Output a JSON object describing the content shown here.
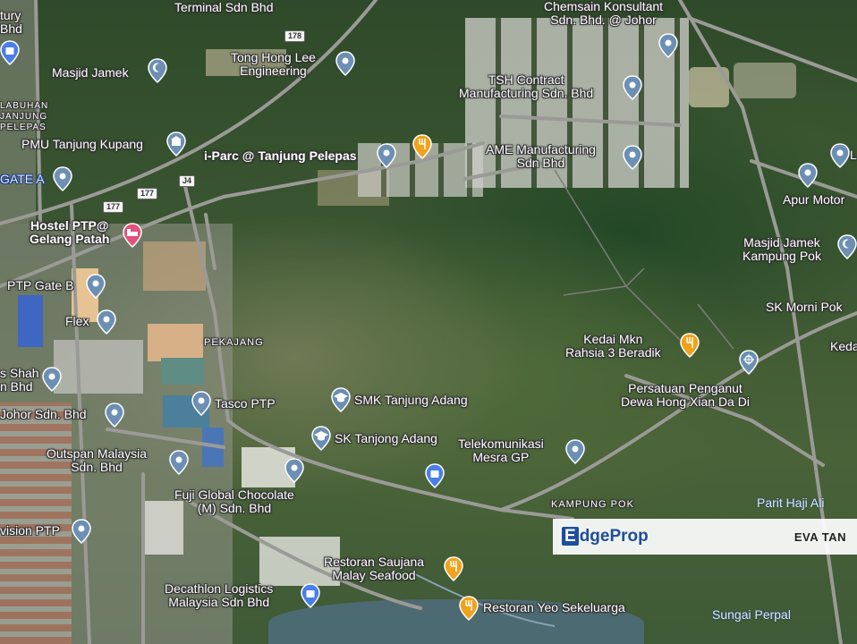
{
  "map": {
    "places": [
      {
        "text": "Terminal Sdn Bhd",
        "kind": "label"
      },
      {
        "text": "Chemsain Konsultant\nSdn. Bhd. @ Johor",
        "kind": "business"
      },
      {
        "text": "tury\nBhd",
        "kind": "label"
      },
      {
        "text": "Tong Hong Lee\nEngineering",
        "kind": "business"
      },
      {
        "text": "Masjid Jamek",
        "kind": "mosque"
      },
      {
        "text": "TSH Contract\nManufacturing Sdn. Bhd",
        "kind": "business"
      },
      {
        "text": "LABUHAN\nJANJUNG\nPELEPAS",
        "kind": "area"
      },
      {
        "text": "PMU Tanjung Kupang",
        "kind": "government"
      },
      {
        "text": "i-Parc @ Tanjung Pelepas",
        "kind": "business"
      },
      {
        "text": "AME Manufacturing\nSdn Bhd",
        "kind": "business"
      },
      {
        "text": "GATE A",
        "kind": "gate"
      },
      {
        "text": "Apur Motor",
        "kind": "business"
      },
      {
        "text": "Hostel PTP@\nGelang Patah",
        "kind": "lodging"
      },
      {
        "text": "Masjid Jamek\nKampung Pok",
        "kind": "mosque"
      },
      {
        "text": "PTP Gate B",
        "kind": "gate"
      },
      {
        "text": "SK Morni Pok",
        "kind": "school"
      },
      {
        "text": "Flex",
        "kind": "business"
      },
      {
        "text": "PEKAJANG",
        "kind": "area"
      },
      {
        "text": "Kedai Mkn\nRahsia 3 Beradik",
        "kind": "restaurant"
      },
      {
        "text": "Keda",
        "kind": "label"
      },
      {
        "text": "s Shah\nn Bhd",
        "kind": "label"
      },
      {
        "text": "Persatuan Penganut\nDewa Hong Xian Da Di",
        "kind": "temple"
      },
      {
        "text": "SMK Tanjung Adang",
        "kind": "school"
      },
      {
        "text": "Johor Sdn. Bhd",
        "kind": "business"
      },
      {
        "text": "Tasco PTP",
        "kind": "business"
      },
      {
        "text": "SK Tanjong Adang",
        "kind": "school"
      },
      {
        "text": "Telekomunikasi\nMesra GP",
        "kind": "business"
      },
      {
        "text": "Outspan Malaysia\nSdn. Bhd",
        "kind": "business"
      },
      {
        "text": "KAMPUNG POK",
        "kind": "area"
      },
      {
        "text": "Parit Haji Ali",
        "kind": "water"
      },
      {
        "text": "Fuji Global Chocolate\n(M) Sdn. Bhd",
        "kind": "business"
      },
      {
        "text": "vision PTP",
        "kind": "business"
      },
      {
        "text": "Restoran Saujana\nMalay Seafood",
        "kind": "restaurant"
      },
      {
        "text": "Decathlon Logistics\nMalaysia Sdn Bhd",
        "kind": "shopping"
      },
      {
        "text": "Restoran Yeo Sekeluarga",
        "kind": "restaurant"
      },
      {
        "text": "Sungai Perpal",
        "kind": "water"
      },
      {
        "text": "L",
        "kind": "label"
      }
    ],
    "roads": [
      {
        "text": "178"
      },
      {
        "text": "177"
      },
      {
        "text": "J4"
      },
      {
        "text": "177"
      }
    ]
  },
  "banner": {
    "brand_prefix": "E",
    "brand_rest": "dgeProp",
    "agent": "EVA TAN"
  }
}
